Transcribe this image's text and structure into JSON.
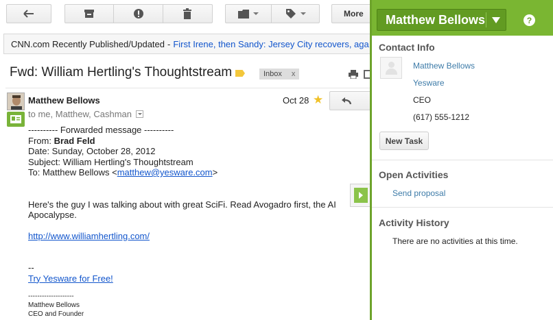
{
  "toolbar": {
    "back_icon": "back-arrow-icon",
    "archive_icon": "archive-icon",
    "spam_icon": "report-spam-icon",
    "delete_icon": "trash-icon",
    "folder_icon": "folder-icon",
    "labels_icon": "label-icon",
    "more_label": "More"
  },
  "ticker": {
    "source": "CNN.com Recently Published/Updated",
    "separator": "-",
    "headline": "First Irene, then Sandy: Jersey City recovers, aga"
  },
  "message": {
    "subject": "Fwd: William Hertling's Thoughtstream",
    "label_chip": "Inbox",
    "label_remove": "x",
    "sender": "Matthew Bellows",
    "recipients": "to me, Matthew, Cashman",
    "date": "Oct 28",
    "star": "★",
    "body": {
      "fwd_header": "---------- Forwarded message ----------",
      "from_label": "From: ",
      "from_value": "Brad Feld",
      "date_line": "Date: Sunday, October 28, 2012",
      "subject_line": "Subject: William Hertling's Thoughtstream",
      "to_label": "To: Matthew Bellows <",
      "to_email": "matthew@yesware.com",
      "to_end": ">",
      "paragraph": "Here's the guy I was talking about with great SciFi. Read Avogadro first, the AI Apocalypse.",
      "link": "http://www.williamhertling.com/",
      "sig_dash": "--",
      "sig_link": "Try Yesware for Free!",
      "sig_rule": "--------------------",
      "sig_name": "Matthew Bellows",
      "sig_title": "CEO and Founder"
    }
  },
  "panel": {
    "contact_name": "Matthew Bellows",
    "help": "?",
    "contact_info_title": "Contact Info",
    "contact_name_link": "Matthew Bellows",
    "company": "Yesware",
    "title": "CEO",
    "phone": "(617) 555-1212",
    "new_task": "New Task",
    "open_activities_title": "Open Activities",
    "open_activity_item": "Send proposal",
    "history_title": "Activity History",
    "history_empty": "There are no activities at this time."
  },
  "colors": {
    "panel_green": "#7ab632",
    "link_blue": "#1155cc",
    "star_yellow": "#f0c128"
  }
}
